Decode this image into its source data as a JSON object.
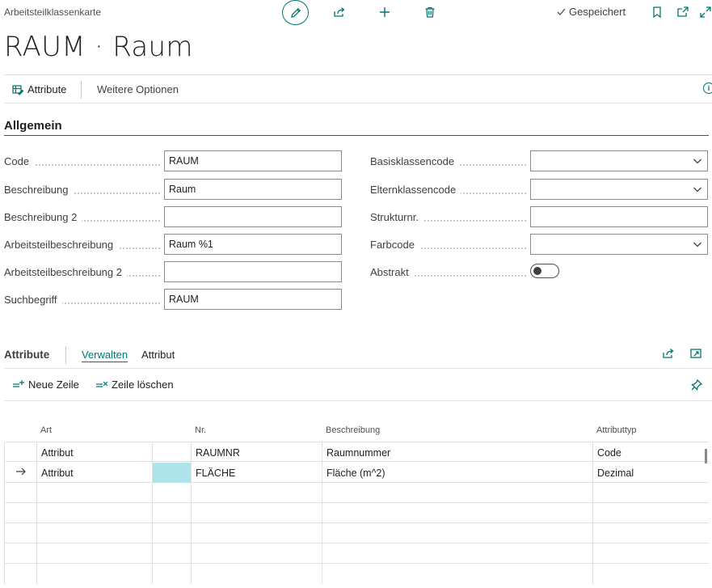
{
  "header": {
    "breadcrumb": "Arbeitsteilklassenkarte",
    "saved_label": "Gespeichert",
    "title": "RAUM · Raum"
  },
  "actionbar": {
    "attribute_label": "Attribute",
    "more_label": "Weitere Optionen"
  },
  "general": {
    "section_title": "Allgemein",
    "left_fields": [
      {
        "label": "Code",
        "value": "RAUM"
      },
      {
        "label": "Beschreibung",
        "value": "Raum"
      },
      {
        "label": "Beschreibung 2",
        "value": ""
      },
      {
        "label": "Arbeitsteilbeschreibung",
        "value": "Raum %1"
      },
      {
        "label": "Arbeitsteilbeschreibung 2",
        "value": ""
      },
      {
        "label": "Suchbegriff",
        "value": "RAUM"
      }
    ],
    "right_fields": [
      {
        "label": "Basisklassencode",
        "value": ""
      },
      {
        "label": "Elternklassencode",
        "value": ""
      },
      {
        "label": "Strukturnr.",
        "value": ""
      },
      {
        "label": "Farbcode",
        "value": ""
      },
      {
        "label": "Abstrakt",
        "value": ""
      }
    ]
  },
  "attributes": {
    "title": "Attribute",
    "tab_manage": "Verwalten",
    "tab_attribute": "Attribut",
    "new_row": "Neue Zeile",
    "delete_row": "Zeile löschen",
    "columns": [
      "Art",
      "Nr.",
      "Beschreibung",
      "Attributtyp"
    ],
    "rows": [
      {
        "art": "Attribut",
        "nr": "RAUMNR",
        "beschreibung": "Raumnummer",
        "typ": "Code"
      },
      {
        "art": "Attribut",
        "nr": "FLÄCHE",
        "beschreibung": "Fläche (m^2)",
        "typ": "Dezimal"
      }
    ]
  },
  "colors": {
    "accent": "#00766f",
    "selected_cell": "#aee4ea"
  }
}
